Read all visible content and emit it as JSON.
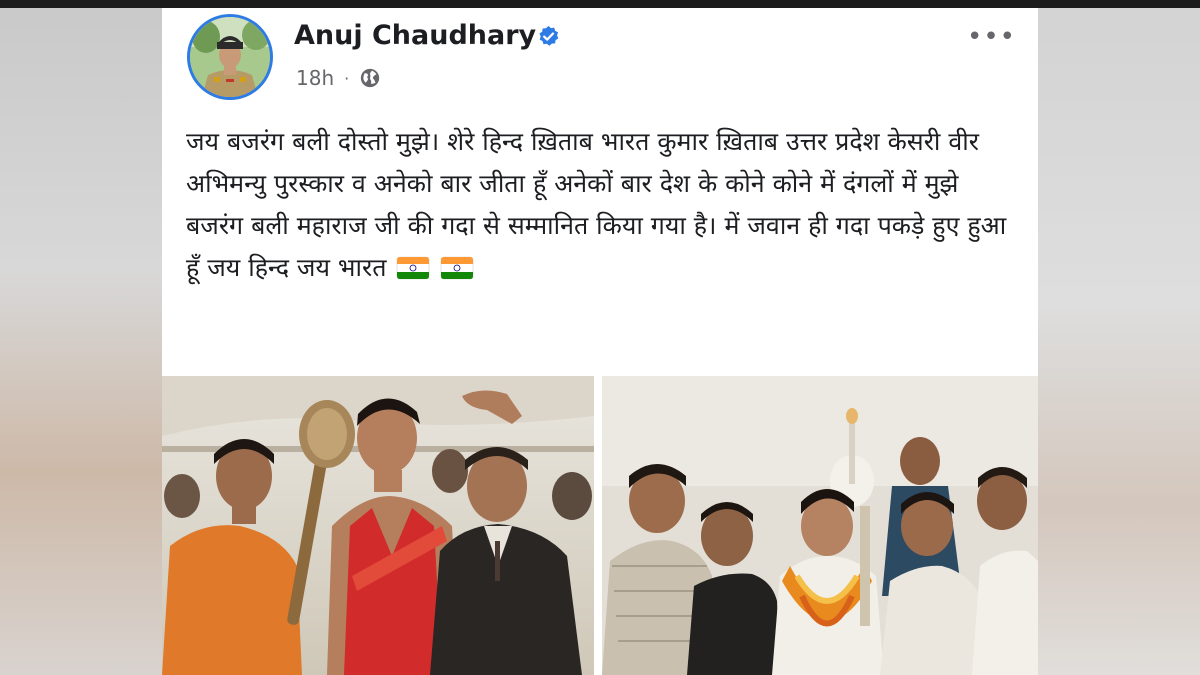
{
  "post": {
    "author": "Anuj Chaudhary",
    "verified": true,
    "time": "18h",
    "separator": "·",
    "privacy_icon": "globe-icon",
    "more_icon": "more-options-icon",
    "more_label": "•••",
    "text": "जय बजरंग बली दोस्तो मुझे। शेरे हिन्द ख़िताब भारत कुमार ख़िताब उत्तर प्रदेश केसरी वीर अभिमन्यु पुरस्कार व अनेको बार जीता हूँ अनेकों बार देश के कोने कोने में दंगलों में मुझे बजरंग बली महाराज जी की गदा से सम्मानित किया गया है। में जवान ही गदा पकड़े हुए हुआ हूँ जय हिन्द जय भारत",
    "flags": [
      "india-flag-icon",
      "india-flag-icon"
    ]
  },
  "photos": [
    {
      "name": "wrestler-with-mace-photo"
    },
    {
      "name": "wrestler-felicitation-photo"
    }
  ],
  "colors": {
    "accent": "#2d7be5",
    "text": "#1c1e21",
    "meta": "#65676b"
  }
}
